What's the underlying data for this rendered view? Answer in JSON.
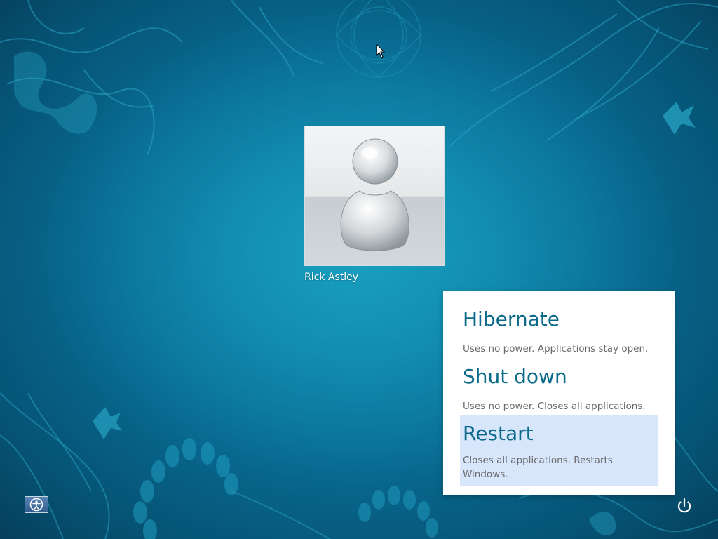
{
  "user": {
    "name": "Rick Astley"
  },
  "power_menu": {
    "items": [
      {
        "label": "Hibernate",
        "description": "Uses no power. Applications stay open."
      },
      {
        "label": "Shut down",
        "description": "Uses no power. Closes all applications."
      },
      {
        "label": "Restart",
        "description": "Closes all applications. Restarts Windows.",
        "highlighted": true
      }
    ]
  },
  "colors": {
    "background_primary": "#0b7ca3",
    "menu_title": "#0b6a8a",
    "menu_desc": "#6a6a6a",
    "highlight": "#d7e6fb"
  },
  "icons": {
    "ease_of_access": "ease-of-access-icon",
    "power": "power-icon",
    "cursor": "mouse-pointer-icon",
    "avatar": "default-user-silhouette"
  }
}
